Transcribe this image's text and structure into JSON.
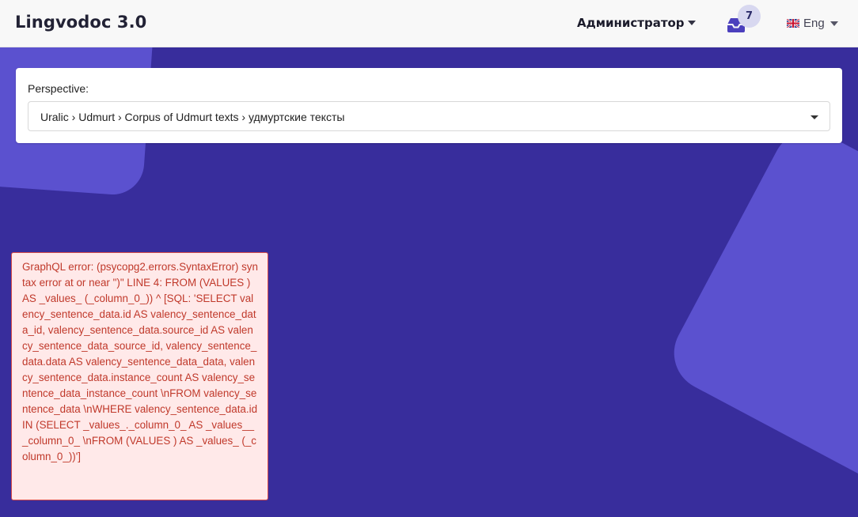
{
  "header": {
    "brand": "Lingvodoc 3.0",
    "user_label": "Администратор",
    "notifications_count": "7",
    "language_label": "Eng"
  },
  "perspective": {
    "label": "Perspective:",
    "value": "Uralic › Udmurt › Corpus of Udmurt texts › удмуртские тексты"
  },
  "error": {
    "message": "GraphQL error: (psycopg2.errors.SyntaxError) syntax error at or near \")\" LINE 4: FROM (VALUES ) AS _values_ (_column_0_)) ^ [SQL: 'SELECT valency_sentence_data.id AS valency_sentence_data_id, valency_sentence_data.source_id AS valency_sentence_data_source_id, valency_sentence_data.data AS valency_sentence_data_data, valency_sentence_data.instance_count AS valency_sentence_data_instance_count \\nFROM valency_sentence_data \\nWHERE valency_sentence_data.id IN (SELECT _values_._column_0_ AS _values___column_0_ \\nFROM (VALUES ) AS _values_ (_column_0_))']"
  },
  "colors": {
    "background": "#382d9c",
    "decoration": "#5b51cf",
    "error_text": "#c0392b",
    "error_bg": "#ffe9e9",
    "error_border": "#d54a4a"
  },
  "icons": {
    "inbox": "inbox-icon",
    "flag": "uk-flag-icon",
    "dropdown": "chevron-down-icon"
  }
}
